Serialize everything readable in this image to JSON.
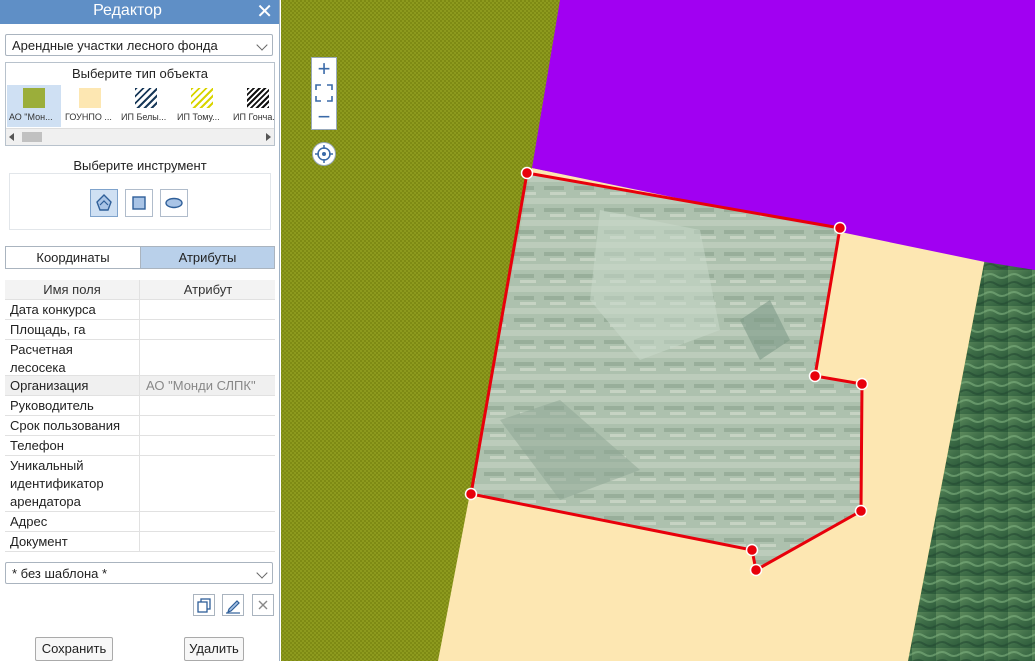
{
  "panel": {
    "title": "Редактор",
    "close_icon": "close-icon",
    "layer_select": "Арендные участки лесного фонда",
    "object_type_title": "Выберите тип объекта",
    "object_types": [
      {
        "label": "АО \"Мон...",
        "swatch": "solid-olive",
        "color": "#9bae3a"
      },
      {
        "label": "ГОУНПО ...",
        "swatch": "solid-cream",
        "color": "#fde7b2"
      },
      {
        "label": "ИП Белы...",
        "swatch": "hatch-navy",
        "color": "#1a3a5a"
      },
      {
        "label": "ИП Тому...",
        "swatch": "hatch-yellow",
        "color": "#d9d400"
      },
      {
        "label": "ИП Гонча...",
        "swatch": "hatch-black",
        "color": "#111111"
      }
    ],
    "tool_title": "Выберите инструмент",
    "tools": [
      "polygon-tool-icon",
      "rectangle-tool-icon",
      "ellipse-tool-icon"
    ],
    "tabs": [
      {
        "label": "Координаты",
        "active": false
      },
      {
        "label": "Атрибуты",
        "active": true
      }
    ],
    "attr_header": {
      "field": "Имя поля",
      "value": "Атрибут"
    },
    "attributes": [
      {
        "field": "Дата конкурса",
        "value": ""
      },
      {
        "field": "Площадь, га",
        "value": ""
      },
      {
        "field": "Расчетная лесосека",
        "value": ""
      },
      {
        "field": "Организация",
        "value": "АО \"Монди СЛПК\""
      },
      {
        "field": "Руководитель",
        "value": ""
      },
      {
        "field": "Срок пользования",
        "value": ""
      },
      {
        "field": "Телефон",
        "value": ""
      },
      {
        "field": "Уникальный идентификатор арендатора",
        "value": ""
      },
      {
        "field": "Адрес",
        "value": ""
      },
      {
        "field": "Документ",
        "value": ""
      }
    ],
    "template_select": "* без шаблона *",
    "action_icons": [
      "copy-icon",
      "edit-icon",
      "delete-icon"
    ],
    "save_label": "Сохранить",
    "delete_label": "Удалить"
  },
  "map": {
    "zoom_controls": [
      "zoom-in-icon",
      "fit-extent-icon",
      "zoom-out-icon"
    ],
    "locate_icon": "locate-icon",
    "colors": {
      "olive": "#8d9a1e",
      "magenta": "#a100f2",
      "cream": "#fde7b2",
      "edit_outline": "#e8000b"
    }
  }
}
